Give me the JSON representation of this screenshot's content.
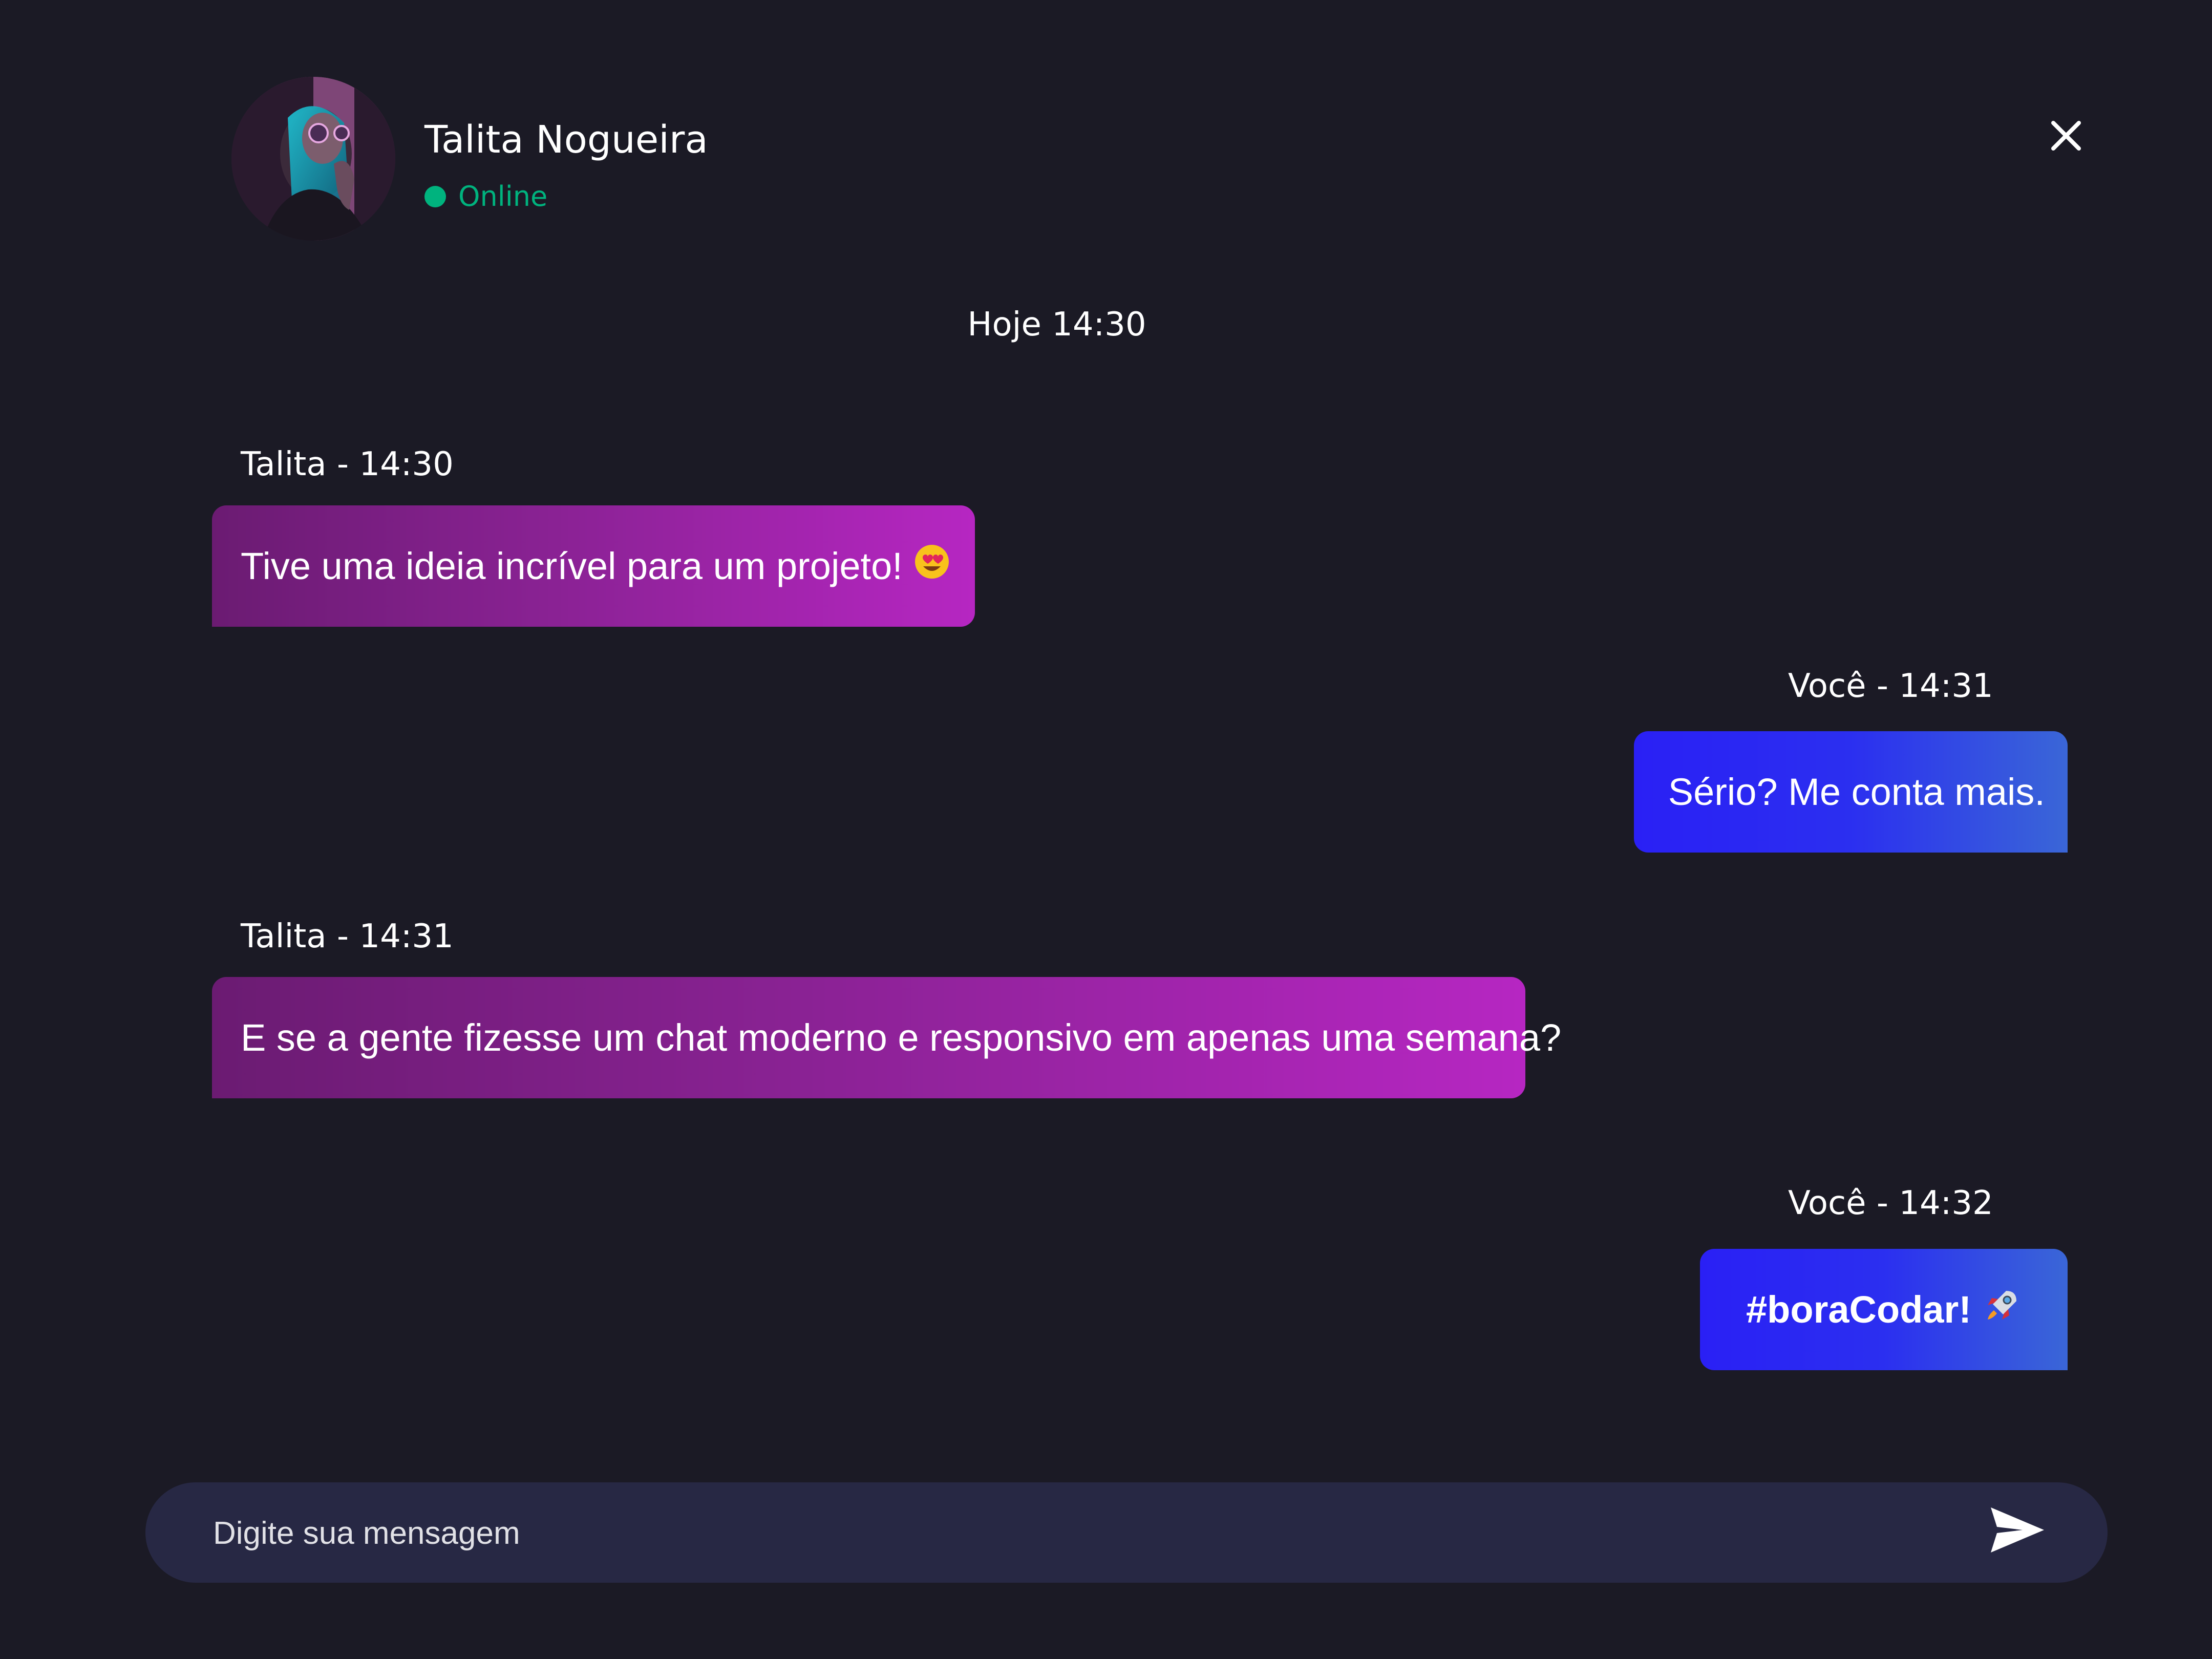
{
  "contact": {
    "name": "Talita Nogueira",
    "status": "Online"
  },
  "day_label": "Hoje 14:30",
  "messages": [
    {
      "meta": "Talita - 14:30",
      "text": "Tive uma ideia incrível para um projeto!",
      "emoji": "heart-eyes-emoji"
    },
    {
      "meta": "Você - 14:31",
      "text": "Sério? Me conta mais."
    },
    {
      "meta": "Talita - 14:31",
      "text": "E se a gente fizesse um chat moderno e responsivo em apenas uma semana?"
    },
    {
      "meta": "Você - 14:32",
      "text": "#boraCodar!",
      "emoji": "rocket-emoji"
    }
  ],
  "composer": {
    "placeholder": "Digite sua mensagem",
    "value": ""
  },
  "colors": {
    "background": "#1b1a25",
    "online": "#00b37e",
    "incoming_bubble_start": "#6b1b72",
    "incoming_bubble_end": "#b626c2",
    "outgoing_bubble_start": "#2a20f5",
    "outgoing_bubble_end": "#3a66d7",
    "composer": "#272844"
  },
  "icons": {
    "close": "close-icon",
    "send": "send-icon",
    "status": "online-dot-icon"
  }
}
